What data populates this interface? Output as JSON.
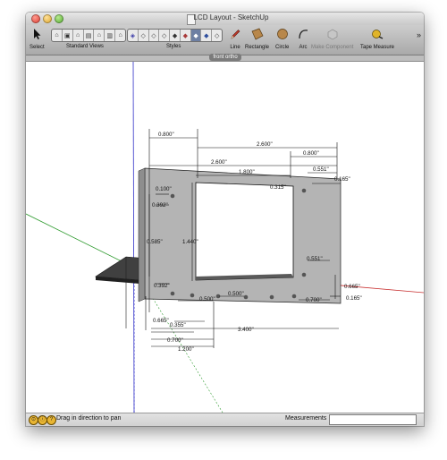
{
  "window": {
    "title": "LCD Layout - SketchUp"
  },
  "toolbar": {
    "select": "Select",
    "standard_views": "Standard Views",
    "styles": "Styles",
    "line": "Line",
    "rectangle": "Rectangle",
    "circle": "Circle",
    "arc": "Arc",
    "make_component": "Make Component",
    "tape_measure": "Tape Measure",
    "overflow": "»"
  },
  "scene_tab": "front ortho",
  "dimensions": {
    "d0800_top": "0.800\"",
    "d2600_top": "2.600\"",
    "d0800_right": "0.800\"",
    "d2600_mid": "2.600\"",
    "d1800": "1.800\"",
    "d0551_top": "0.551\"",
    "d0100": "0.100\"",
    "d0392_top": "0.392\"",
    "d0315": "0.315\"",
    "d0165": "0.165\"",
    "d0585": "0.585\"",
    "d1440": "1.440\"",
    "d0551_bot": "0.551\"",
    "d0392_bot": "0.392\"",
    "d0665_right": "0.665\"",
    "d0500_a": "0.500\"",
    "d0500_b": "0.500\"",
    "d0700_right": "0.700\"",
    "d0165_bot": "0.165\"",
    "d0665_left": "0.665\"",
    "d0355": "0.355\"",
    "d3400": "3.400\"",
    "d0700_left": "0.700\"",
    "d1200": "1.200\""
  },
  "status": {
    "message": "Drag in direction to pan",
    "measurements_label": "Measurements",
    "measurements_value": ""
  }
}
